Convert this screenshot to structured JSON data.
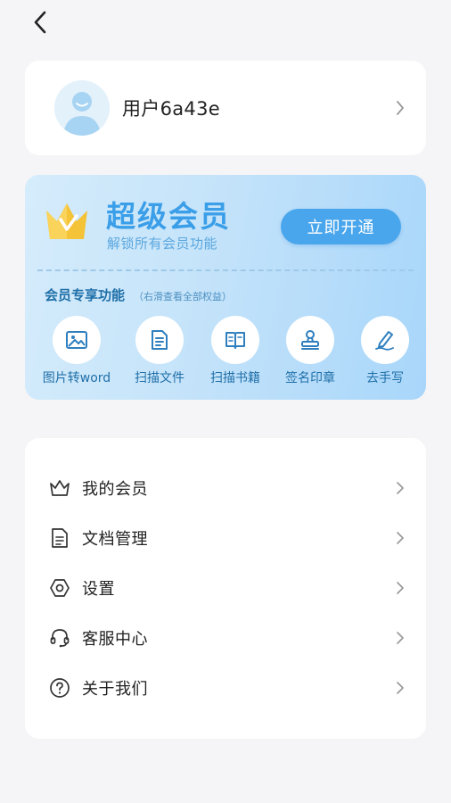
{
  "nav": {
    "back_icon": "chevron-left-icon"
  },
  "profile": {
    "username": "用户6a43e",
    "avatar_icon": "user-avatar-icon"
  },
  "vip": {
    "title": "超级会员",
    "subtitle": "解锁所有会员功能",
    "button_label": "立即开通",
    "features_title": "会员专享功能",
    "features_hint": "（右滑查看全部权益）",
    "features": [
      {
        "label": "图片转word",
        "icon": "image-icon"
      },
      {
        "label": "扫描文件",
        "icon": "document-icon"
      },
      {
        "label": "扫描书籍",
        "icon": "book-icon"
      },
      {
        "label": "签名印章",
        "icon": "stamp-icon"
      },
      {
        "label": "去手写",
        "icon": "pen-icon"
      }
    ],
    "colors": {
      "accent": "#3a9ee8",
      "button": "#4aa6ec",
      "crown": "#f5c338"
    }
  },
  "menu": {
    "items": [
      {
        "label": "我的会员",
        "icon": "crown-icon"
      },
      {
        "label": "文档管理",
        "icon": "document-icon"
      },
      {
        "label": "设置",
        "icon": "settings-icon"
      },
      {
        "label": "客服中心",
        "icon": "headset-icon"
      },
      {
        "label": "关于我们",
        "icon": "help-icon"
      }
    ]
  }
}
